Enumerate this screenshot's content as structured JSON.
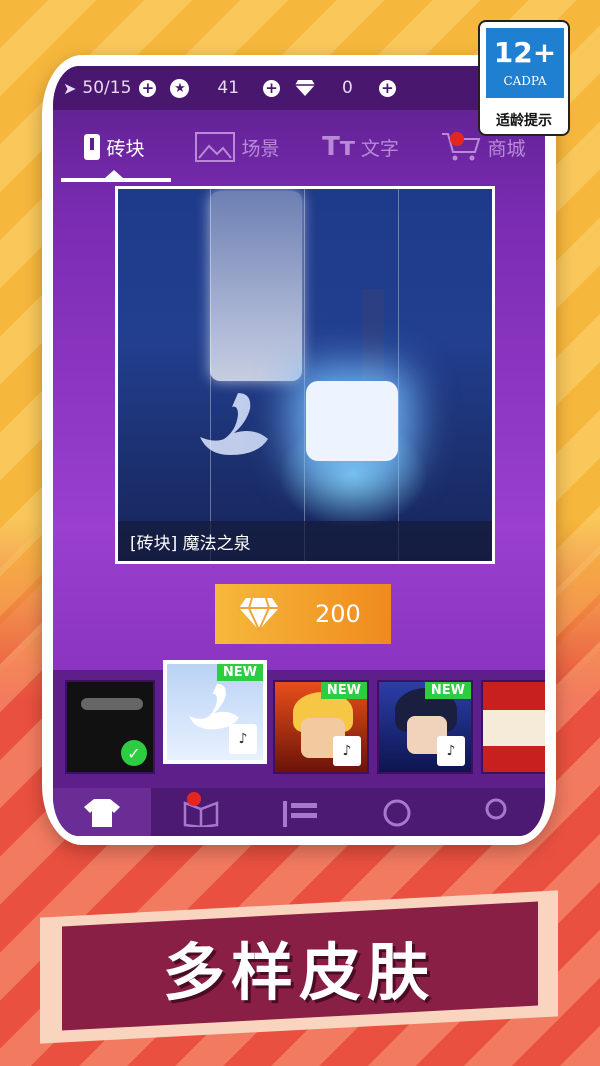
{
  "status_bar": {
    "energy": "50/15",
    "coins": "41",
    "gems": "0"
  },
  "tabs": [
    {
      "label": "砖块",
      "icon": "tile-icon",
      "active": true
    },
    {
      "label": "场景",
      "icon": "image-icon",
      "active": false
    },
    {
      "label": "文字",
      "icon": "text-icon",
      "active": false
    },
    {
      "label": "商城",
      "icon": "cart-icon",
      "active": false
    }
  ],
  "preview": {
    "caption": "[砖块] 魔法之泉"
  },
  "purchase": {
    "price": "200"
  },
  "skins": [
    {
      "name": "default-skin",
      "status": "owned"
    },
    {
      "name": "swan-skin",
      "badge": "NEW",
      "status": "locked",
      "selected": true
    },
    {
      "name": "naruto-skin",
      "badge": "NEW",
      "status": "locked"
    },
    {
      "name": "sasuke-skin",
      "badge": "NEW",
      "status": "locked"
    },
    {
      "name": "gift-skin",
      "status": "partial"
    }
  ],
  "bottom_nav": [
    {
      "icon": "shirt-icon",
      "active": true
    },
    {
      "icon": "book-icon",
      "active": false
    },
    {
      "icon": "music-list-icon",
      "active": false
    },
    {
      "icon": "search-icon",
      "active": false
    },
    {
      "icon": "profile-icon",
      "active": false
    }
  ],
  "age_badge": {
    "rating": "12+",
    "org": "CADPA",
    "tip": "适龄提示"
  },
  "banner": {
    "title": "多样皮肤"
  },
  "colors": {
    "accent_purple": "#7b2cb3",
    "price_orange": "#f08a1e",
    "new_green": "#2ecc40",
    "banner_red": "#8a1f45"
  }
}
